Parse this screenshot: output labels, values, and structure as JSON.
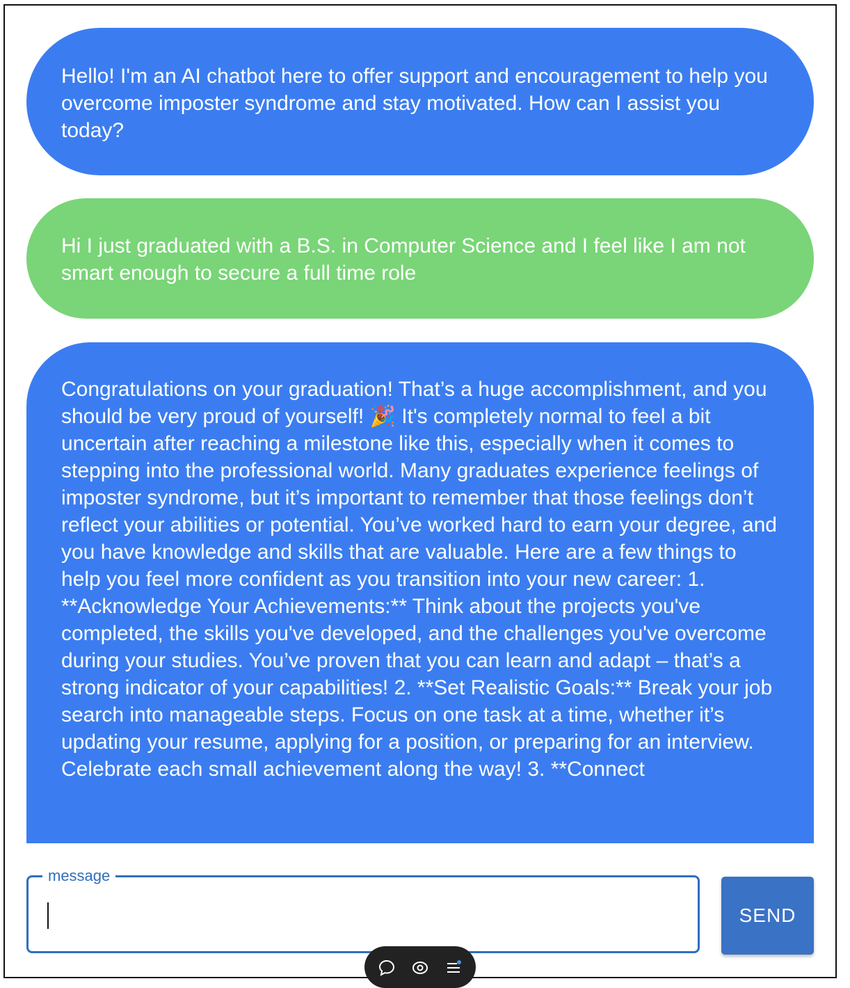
{
  "messages": [
    {
      "role": "bot",
      "text": "Hello! I'm an AI chatbot here to offer support and encouragement to help you overcome imposter syndrome and stay motivated. How can I assist you today?"
    },
    {
      "role": "user",
      "text": "Hi I just graduated with a B.S. in Computer Science and I feel like I am not smart enough to secure a full time role"
    },
    {
      "role": "bot",
      "text": "Congratulations on your graduation! That’s a huge accomplishment, and you should be very proud of yourself! 🎉 It's completely normal to feel a bit uncertain after reaching a milestone like this, especially when it comes to stepping into the professional world. Many graduates experience feelings of imposter syndrome, but it’s important to remember that those feelings don’t reflect your abilities or potential. You’ve worked hard to earn your degree, and you have knowledge and skills that are valuable. Here are a few things to help you feel more confident as you transition into your new career: 1. **Acknowledge Your Achievements:** Think about the projects you've completed, the skills you've developed, and the challenges you've overcome during your studies. You’ve proven that you can learn and adapt – that’s a strong indicator of your capabilities! 2. **Set Realistic Goals:** Break your job search into manageable steps. Focus on one task at a time, whether it’s updating your resume, applying for a position, or preparing for an interview. Celebrate each small achievement along the way! 3. **Connect"
    }
  ],
  "composer": {
    "label": "message",
    "value": "",
    "placeholder": ""
  },
  "send_label": "SEND",
  "colors": {
    "bot_bubble": "#3b7df1",
    "user_bubble": "#79d577",
    "accent": "#2f6fbd",
    "send_button": "#3a72c6"
  },
  "toolbar": {
    "icons": [
      "comment-icon",
      "eye-icon",
      "menu-icon"
    ]
  }
}
